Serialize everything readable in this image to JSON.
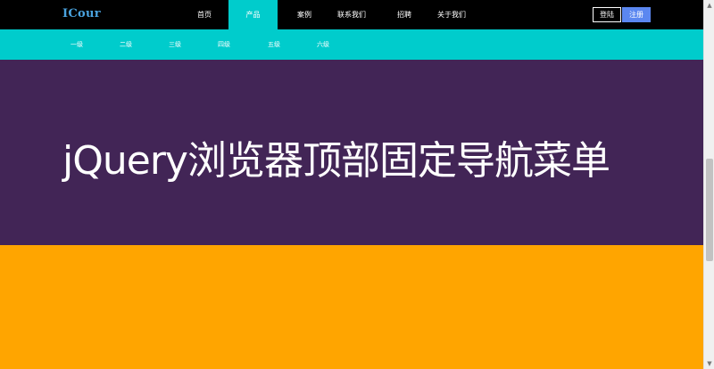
{
  "brand": {
    "logo_text": "ICour",
    "logo_color": "#4aa3df"
  },
  "nav": {
    "items": [
      {
        "label": "首页",
        "active": false
      },
      {
        "label": "产品",
        "active": true
      },
      {
        "label": "案例",
        "active": false
      },
      {
        "label": "联系我们",
        "active": false
      },
      {
        "label": "招聘",
        "active": false
      },
      {
        "label": "关于我们",
        "active": false
      }
    ],
    "login_label": "登陆",
    "register_label": "注册"
  },
  "submenu": {
    "items": [
      {
        "label": "一级"
      },
      {
        "label": "二级"
      },
      {
        "label": "三级"
      },
      {
        "label": "四级"
      },
      {
        "label": "五级"
      },
      {
        "label": "六级"
      }
    ]
  },
  "hero": {
    "title": "jQuery浏览器顶部固定导航菜单"
  },
  "colors": {
    "topbar": "#000000",
    "accent_teal": "#00cccc",
    "hero_purple": "#422556",
    "lower_orange": "#ffa500",
    "register_blue": "#5b87f0"
  },
  "scrollbar": {
    "up_icon": "scroll-up-arrow",
    "down_icon": "scroll-down-arrow"
  }
}
